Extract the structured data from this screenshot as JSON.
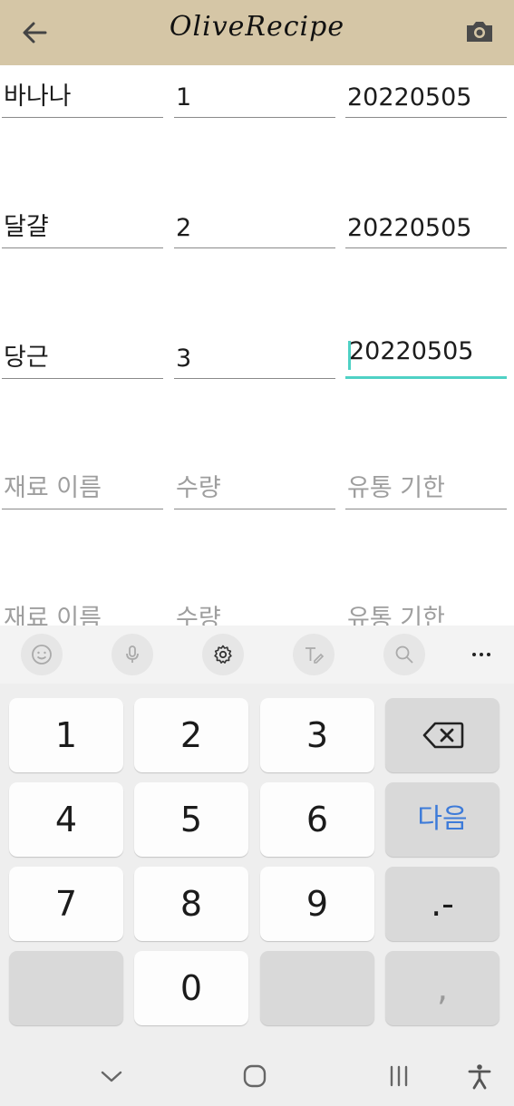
{
  "app": {
    "title": "OliveRecipe"
  },
  "ingredients": [
    {
      "name": "바나나",
      "quantity": "1",
      "expiry": "20220505"
    },
    {
      "name": "달걀",
      "quantity": "2",
      "expiry": "20220505"
    },
    {
      "name": "당근",
      "quantity": "3",
      "expiry": "20220505"
    },
    {
      "name": "",
      "quantity": "",
      "expiry": ""
    },
    {
      "name": "",
      "quantity": "",
      "expiry": ""
    }
  ],
  "placeholders": {
    "name": "재료 이름",
    "quantity": "수량",
    "expiry": "유통 기한"
  },
  "keyboard": {
    "keys": [
      "1",
      "2",
      "3",
      "4",
      "5",
      "6",
      "7",
      "8",
      "9",
      "0"
    ],
    "next_label": "다음",
    "symbols_label": ".-",
    "comma_label": ",",
    "more_label": "···"
  },
  "colors": {
    "appbar": "#d5c6a6",
    "accent": "#4fd1c5",
    "next": "#3d7bd9"
  }
}
